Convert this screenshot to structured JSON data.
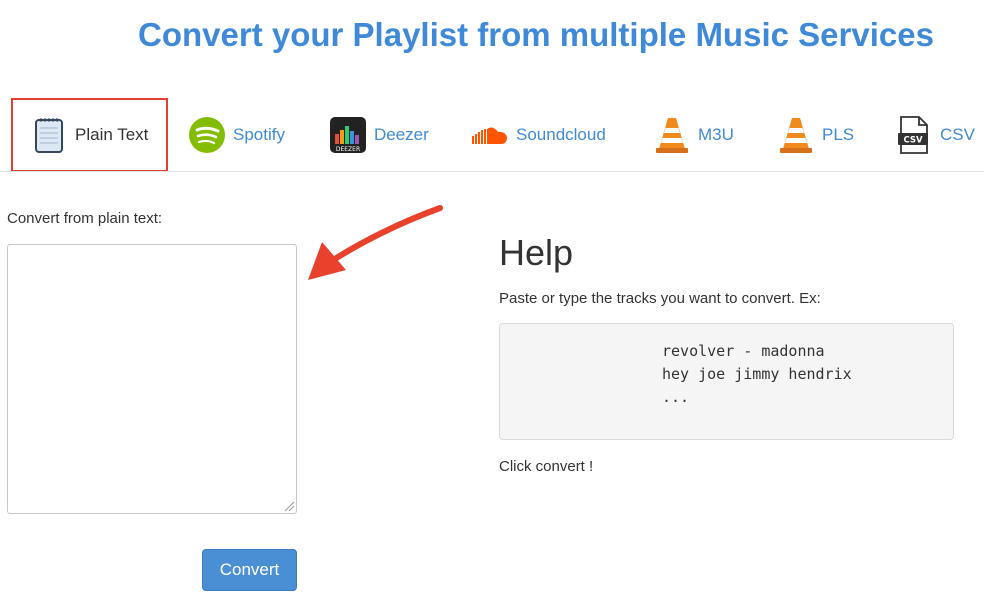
{
  "title": "Convert your Playlist from multiple Music Services",
  "tabs": [
    {
      "label": "Plain Text",
      "icon": "notepad-icon",
      "active": true
    },
    {
      "label": "Spotify",
      "icon": "spotify-icon",
      "active": false
    },
    {
      "label": "Deezer",
      "icon": "deezer-icon",
      "active": false
    },
    {
      "label": "Soundcloud",
      "icon": "soundcloud-icon",
      "active": false
    },
    {
      "label": "M3U",
      "icon": "vlc-cone-icon",
      "active": false
    },
    {
      "label": "PLS",
      "icon": "vlc-cone-icon",
      "active": false
    },
    {
      "label": "CSV",
      "icon": "csv-file-icon",
      "active": false
    }
  ],
  "form": {
    "label": "Convert from plain text:",
    "textarea_value": "",
    "convert_label": "Convert"
  },
  "help": {
    "title": "Help",
    "intro": "Paste or type the tracks you want to convert. Ex:",
    "examples": [
      "revolver - madonna",
      "hey joe jimmy hendrix",
      "..."
    ],
    "outro": "Click convert !"
  },
  "colors": {
    "accent": "#3f8ad8",
    "highlight": "#e53e2b",
    "button": "#4a8fd4",
    "spotify": "#84bd00",
    "soundcloud": "#ff5500",
    "vlc": "#f08a1c"
  }
}
